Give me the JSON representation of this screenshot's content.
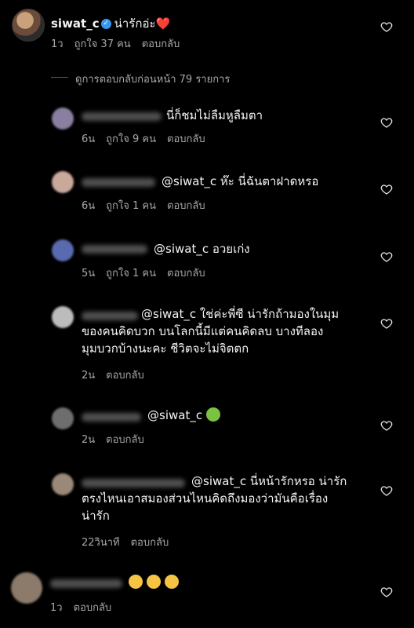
{
  "main_comment": {
    "username": "siwat_c",
    "text": "น่ารักอ่ะ",
    "heart_emoji": "❤️",
    "time": "1ว",
    "likes": "ถูกใจ 37 คน",
    "reply": "ตอบกลับ"
  },
  "view_previous": "ดูการตอบกลับก่อนหน้า 79 รายการ",
  "replies": [
    {
      "text": "นี่ก็ชมไม่ลืมหูลืมตา",
      "time": "6น",
      "likes": "ถูกใจ 9 คน",
      "reply": "ตอบกลับ"
    },
    {
      "mention": "@siwat_c",
      "text": "ห๊ะ นี่ฉันตาฝาดหรอ",
      "time": "6น",
      "likes": "ถูกใจ 1 คน",
      "reply": "ตอบกลับ"
    },
    {
      "mention": "@siwat_c",
      "text": "อวยเก่ง",
      "time": "5น",
      "likes": "ถูกใจ 1 คน",
      "reply": "ตอบกลับ"
    },
    {
      "mention": "@siwat_c",
      "line1": "ใช่ค่ะพี่ซี น่ารักถ้ามองในมุม",
      "line2": "ของคนคิดบวก บนโลกนี้มีแต่คนคิดลบ บางทีลอง",
      "line3": "มุมบวกบ้างนะคะ ชีวิตจะไม่จิตตก",
      "time": "2น",
      "reply": "ตอบกลับ"
    },
    {
      "mention": "@siwat_c",
      "time": "2น",
      "reply": "ตอบกลับ"
    },
    {
      "mention": "@siwat_c",
      "line1": "นี่หน้ารักหรอ น่ารัก",
      "line2": "ตรงไหนเอาสมองส่วนไหนคิดถึงมองว่ามันคือเรื่อง",
      "line3": "น่ารัก",
      "time": "22วินาที",
      "reply": "ตอบกลับ"
    }
  ],
  "last_comment": {
    "time": "1ว",
    "reply": "ตอบกลับ"
  },
  "colors": {
    "background": "#000000",
    "muted": "#a8a8a8",
    "verified": "#3897f0",
    "heart_red": "#ed4956"
  }
}
